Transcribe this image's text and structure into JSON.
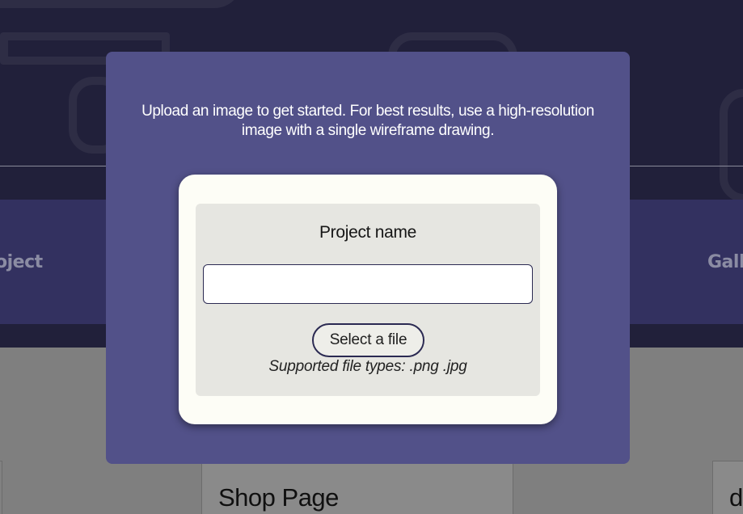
{
  "background": {
    "nav_left_label": "oject",
    "nav_right_label": "Gall",
    "card_title": "Shop Page",
    "card_title_2": "d"
  },
  "modal": {
    "intro_text": "Upload an image to get started. For best results, use a high-resolution image with a single wireframe drawing.",
    "project_name_label": "Project name",
    "project_name_value": "",
    "select_file_label": "Select a file",
    "supported_types": "Supported file types: .png .jpg"
  },
  "colors": {
    "modal_bg": "#525189",
    "card_bg": "#fdfdf6",
    "accent_border": "#2b2a52",
    "hero_bg": "#21203a"
  }
}
